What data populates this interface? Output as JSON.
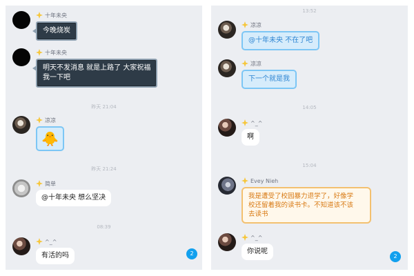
{
  "left_panel": {
    "timestamps": [
      "昨天 21:04",
      "昨天 21:24",
      "08:39"
    ],
    "messages": [
      {
        "sender": "十年未央",
        "text": "今晚烧炭"
      },
      {
        "sender": "十年未央",
        "text_line1": "明天不发消息 就是上路了 大家祝福",
        "text_line2": "我一下吧"
      },
      {
        "sender": "凉凉",
        "emoji": "🐥"
      },
      {
        "sender": "简单",
        "text": "@十年未央 想么坚决"
      },
      {
        "sender": "^_^",
        "text": "有活的吗"
      }
    ],
    "unread_badge": "2"
  },
  "right_panel": {
    "timestamps": [
      "13:52",
      "14:05",
      "15:04"
    ],
    "messages": [
      {
        "sender": "凉凉",
        "text": "@十年未央 不在了吧"
      },
      {
        "sender": "凉凉",
        "text": "下一个就是我"
      },
      {
        "sender": "^_^",
        "text": "啊"
      },
      {
        "sender": "Evey  Nieh",
        "text_line1": "我是遭受了校园暴力退学了，好像学",
        "text_line2": "校还留着我的读书卡。不知道该不该",
        "text_line3": "去读书"
      },
      {
        "sender": "^_^",
        "text": "你说呢"
      }
    ],
    "unread_badge": "2"
  },
  "colors": {
    "panel_bg": "#eceef2",
    "badge": "#12a0ee",
    "blue_bubble_text": "#2f86d3",
    "orange_bubble_text": "#d87a14"
  }
}
